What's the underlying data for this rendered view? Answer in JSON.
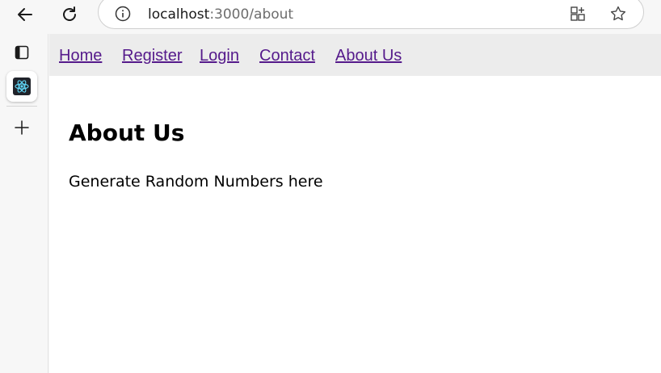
{
  "browser": {
    "back_icon": "arrow-left-icon",
    "refresh_icon": "refresh-icon",
    "address": {
      "host": "localhost",
      "path": ":3000/about",
      "info_icon": "info-icon",
      "apps_icon": "add-app-icon",
      "favorite_icon": "star-icon"
    }
  },
  "sidebar": {
    "items": [
      {
        "icon": "tab-actions-icon"
      },
      {
        "icon": "react-logo-icon"
      },
      {
        "icon": "plus-icon"
      }
    ]
  },
  "site_nav": {
    "links": [
      {
        "label": "Home"
      },
      {
        "label": "Register"
      },
      {
        "label": "Login"
      },
      {
        "label": "Contact"
      },
      {
        "label": "About Us"
      }
    ],
    "link_color": "#551a8b"
  },
  "page": {
    "title": "About Us",
    "text": "Generate Random Numbers here"
  }
}
